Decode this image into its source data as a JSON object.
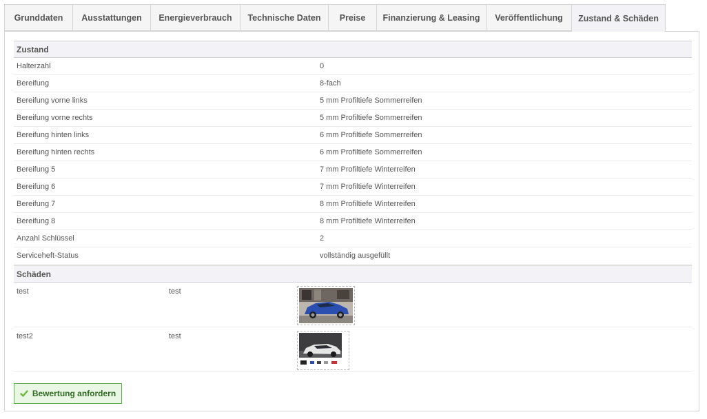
{
  "tabs": [
    {
      "label": "Grunddaten",
      "active": false
    },
    {
      "label": "Ausstattungen",
      "active": false
    },
    {
      "label": "Energieverbrauch",
      "active": false
    },
    {
      "label": "Technische Daten",
      "active": false
    },
    {
      "label": "Preise",
      "active": false
    },
    {
      "label": "Finanzierung & Leasing",
      "active": false
    },
    {
      "label": "Veröffentlichung",
      "active": false
    },
    {
      "label": "Zustand & Schäden",
      "active": true
    }
  ],
  "zustand": {
    "title": "Zustand",
    "rows": [
      {
        "label": "Halterzahl",
        "value": "0"
      },
      {
        "label": "Bereifung",
        "value": "8-fach"
      },
      {
        "label": "Bereifung vorne links",
        "value": "5 mm Profiltiefe Sommerreifen"
      },
      {
        "label": "Bereifung vorne rechts",
        "value": "5 mm Profiltiefe Sommerreifen"
      },
      {
        "label": "Bereifung hinten links",
        "value": "6 mm Profiltiefe Sommerreifen"
      },
      {
        "label": "Bereifung hinten rechts",
        "value": "6 mm Profiltiefe Sommerreifen"
      },
      {
        "label": "Bereifung 5",
        "value": "7 mm Profiltiefe Winterreifen"
      },
      {
        "label": "Bereifung 6",
        "value": "7 mm Profiltiefe Winterreifen"
      },
      {
        "label": "Bereifung 7",
        "value": "8 mm Profiltiefe Winterreifen"
      },
      {
        "label": "Bereifung 8",
        "value": "8 mm Profiltiefe Winterreifen"
      },
      {
        "label": "Anzahl Schlüssel",
        "value": "2"
      },
      {
        "label": "Serviceheft-Status",
        "value": "vollständig ausgefüllt"
      }
    ]
  },
  "schaeden": {
    "title": "Schäden",
    "items": [
      {
        "label": "test",
        "description": "test",
        "image": "blue-hatchback-photo"
      },
      {
        "label": "test2",
        "description": "test",
        "image": "white-sedan-photo"
      }
    ]
  },
  "actions": {
    "request_label": "Bewertung anfordern"
  },
  "colors": {
    "header_bg": "#f3f3f7",
    "button_bg": "#e9f7e4",
    "button_border": "#5fae4f",
    "button_text": "#2f6b21",
    "blue_car": "#2b4fb0"
  }
}
